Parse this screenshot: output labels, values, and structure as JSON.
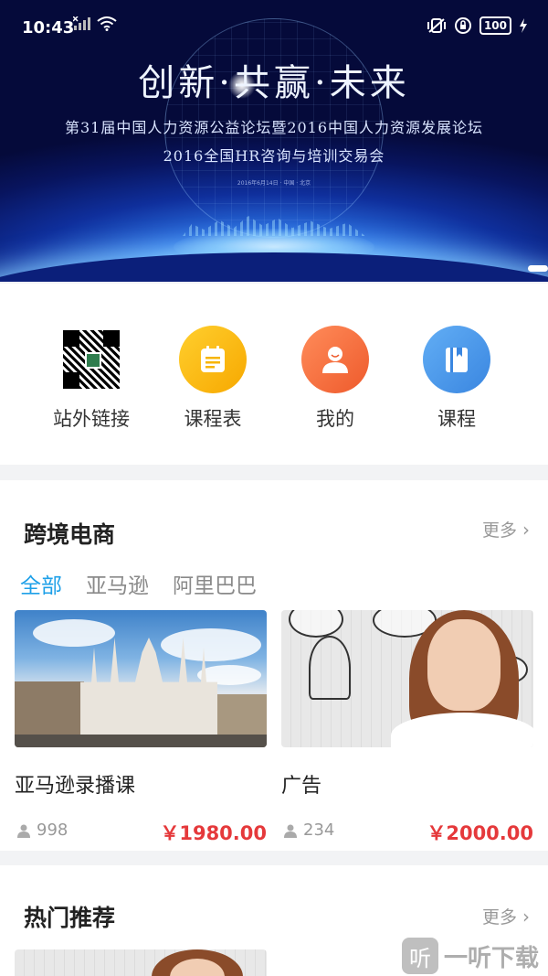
{
  "status_bar": {
    "time": "10:43",
    "battery": "100"
  },
  "banner": {
    "title": "创新·共赢·未来",
    "subtitle_line1": "第31届中国人力资源公益论坛暨2016中国人力资源发展论坛",
    "subtitle_line2": "2016全国HR咨询与培训交易会",
    "subtitle_line3": "2016年6月14日 · 中国 · 北京"
  },
  "quick_menu": {
    "items": [
      {
        "label": "站外链接",
        "icon": "qr-code-icon"
      },
      {
        "label": "课程表",
        "icon": "schedule-icon",
        "color": "#f7b500"
      },
      {
        "label": "我的",
        "icon": "user-icon",
        "color": "#f16a3a"
      },
      {
        "label": "课程",
        "icon": "book-icon",
        "color": "#3a8ee6"
      }
    ]
  },
  "section_cross_border": {
    "title": "跨境电商",
    "more": "更多",
    "tabs": [
      "全部",
      "亚马逊",
      "阿里巴巴"
    ],
    "active_tab": "全部",
    "cards": [
      {
        "name": "亚马逊录播课",
        "count": "998",
        "price": "￥1980.00"
      },
      {
        "name": "广告",
        "count": "234",
        "price": "￥2000.00"
      }
    ]
  },
  "section_hot": {
    "title": "热门推荐",
    "more": "更多"
  },
  "watermark": {
    "logo": "听",
    "text": "一听下载"
  },
  "colors": {
    "accent": "#1ea0e8",
    "price": "#e5393b",
    "background": "#f2f3f5"
  }
}
